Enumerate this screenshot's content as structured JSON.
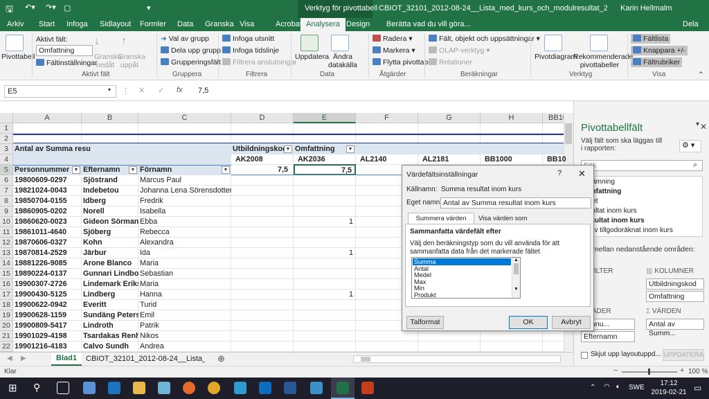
{
  "titlebar": {
    "context_group": "Verktyg för pivottabell",
    "doc_title": "CBIOT_32101_2012-08-24__Lista_med_kurs_och_modulresultat_2019-02-21.csv [Sk...",
    "user": "Karin Hellmalm",
    "share": "Dela"
  },
  "tabs": [
    "Arkiv",
    "Start",
    "Infoga",
    "Sidlayout",
    "Formler",
    "Data",
    "Granska",
    "Visa",
    "Acrobat",
    "Analysera",
    "Design"
  ],
  "tell_me": "Berätta vad du vill göra...",
  "ribbon": {
    "pivot_label": "Pivottabell",
    "active_field_label": "Aktivt fält:",
    "active_field_value": "Omfattning",
    "field_settings": "Fältinställningar",
    "drill_down": "Granska nedåt",
    "drill_up": "Granska uppåt",
    "group_active_field": "Aktivt fält",
    "group_selection": "Val av grupp",
    "ungroup": "Dela upp grupp",
    "group_field": "Grupperingsfält",
    "group_grouping": "Gruppera",
    "insert_slicer": "Infoga utsnitt",
    "insert_timeline": "Infoga tidslinje",
    "filter_connections": "Filtrera anslutningar",
    "group_filter": "Filtrera",
    "refresh": "Uppdatera",
    "change_source": "Ändra datakälla",
    "group_data": "Data",
    "clear": "Radera",
    "select": "Markera",
    "move_pivot": "Flytta pivottabell",
    "group_actions": "Åtgärder",
    "fields_items_sets": "Fält, objekt och uppsättningar",
    "olap_tools": "OLAP-verktyg",
    "relations": "Relationer",
    "group_calculations": "Beräkningar",
    "pivotchart": "Pivotdiagram",
    "recommended": "Rekommenderade pivottabeller",
    "group_tools": "Verktyg",
    "field_list": "Fältlista",
    "buttons": "Knappara +/-",
    "field_headers": "Fältrubriker",
    "group_show": "Visa"
  },
  "formula": {
    "namebox": "E5",
    "value": "7,5"
  },
  "columns": [
    "A",
    "B",
    "C",
    "D",
    "E",
    "F",
    "G",
    "H",
    "BB10"
  ],
  "pivot": {
    "title": "Antal av Summa resu",
    "col_field1": "Utbildningskod",
    "col_field2": "Omfattning",
    "col_codes": [
      "AK2008",
      "AK2036",
      "AL2140",
      "AL2181",
      "BB1000",
      "BB10"
    ],
    "row_headers": [
      "Personnummer",
      "Efternamn",
      "Förnamn"
    ],
    "row5_values": [
      "7,5",
      "7,5"
    ],
    "rows": [
      {
        "n": "6",
        "pnr": "19800609-0297",
        "last": "Sjöstrand",
        "first": "Marcus Paul",
        "e": ""
      },
      {
        "n": "7",
        "pnr": "19821024-0043",
        "last": "Indebetou",
        "first": "Johanna Lena Sörensdotter",
        "e": ""
      },
      {
        "n": "8",
        "pnr": "19850704-0155",
        "last": "Idberg",
        "first": "Fredrik",
        "e": ""
      },
      {
        "n": "9",
        "pnr": "19860905-0202",
        "last": "Norell",
        "first": "Isabella",
        "e": ""
      },
      {
        "n": "10",
        "pnr": "19860620-0023",
        "last": "Gideon Sörman",
        "first": "Ebba",
        "e": "1"
      },
      {
        "n": "11",
        "pnr": "19861011-4640",
        "last": "Sjöberg",
        "first": "Rebecca",
        "e": ""
      },
      {
        "n": "12",
        "pnr": "19870606-0327",
        "last": "Kohn",
        "first": "Alexandra",
        "e": ""
      },
      {
        "n": "13",
        "pnr": "19870814-2529",
        "last": "Järbur",
        "first": "Ida",
        "e": "1"
      },
      {
        "n": "14",
        "pnr": "19881226-9085",
        "last": "Arone Blanco",
        "first": "Maria",
        "e": ""
      },
      {
        "n": "15",
        "pnr": "19890224-0137",
        "last": "Gunnari Lindbom",
        "first": "Sebastian",
        "e": ""
      },
      {
        "n": "16",
        "pnr": "19900307-2726",
        "last": "Lindemark Eriks",
        "first": "Maria",
        "e": ""
      },
      {
        "n": "17",
        "pnr": "19900430-5125",
        "last": "Lindberg",
        "first": "Hanna",
        "e": "1"
      },
      {
        "n": "18",
        "pnr": "19900622-0942",
        "last": "Everitt",
        "first": "Turid",
        "e": ""
      },
      {
        "n": "19",
        "pnr": "19900628-1159",
        "last": "Sundäng Peters",
        "first": "Emil",
        "e": ""
      },
      {
        "n": "20",
        "pnr": "19900809-5417",
        "last": "Lindroth",
        "first": "Patrik",
        "e": ""
      },
      {
        "n": "21",
        "pnr": "19901029-4198",
        "last": "Tsardakas Renh",
        "first": "Nikos",
        "e": ""
      },
      {
        "n": "22",
        "pnr": "19901216-4183",
        "last": "Calvo Sundh",
        "first": "Andrea",
        "e": ""
      }
    ]
  },
  "sheets": {
    "active": "Blad1",
    "other": "CBIOT_32101_2012-08-24__Lista_m"
  },
  "status": {
    "ready": "Klar",
    "zoom": "100 %"
  },
  "pane": {
    "title": "Pivottabellfält",
    "subtitle": "Välj fält som ska läggas till i rapporten:",
    "search": "Sök",
    "fields": [
      "enämning",
      "Omfattning",
      "nhet",
      "esultat inom kurs",
      "resultat inom kurs",
      "arav tillgodoräknat inom kurs"
    ],
    "drag_label": "fält mellan nedanstående områden:",
    "filter": "FILTER",
    "columns": "KOLUMNER",
    "col_items": [
      "Utbildningskod",
      "Omfattning"
    ],
    "rows": "RADER",
    "values": "VÄRDEN",
    "row_items": [
      "sonnu...",
      "Efternamn"
    ],
    "value_items": [
      "Antal av Summ..."
    ],
    "defer": "Skjut upp layoutuppd...",
    "update": "UPPDATERA"
  },
  "dialog": {
    "title": "Värdefältsinställningar",
    "source_label": "Källnamn:",
    "source_value": "Summa resultat inom kurs",
    "custom_label": "Eget namn:",
    "custom_value": "Antal av Summa resultat inom kurs",
    "tab1": "Summera värden efter",
    "tab2": "Visa värden som",
    "section": "Sammanfatta värdefält efter",
    "desc": "Välj den beräkningstyp som du vill använda för att sammanfatta data från det markerade fältet",
    "options": [
      "Summa",
      "Antal",
      "Medel",
      "Max",
      "Min",
      "Produkt"
    ],
    "number_format": "Talformat",
    "ok": "OK",
    "cancel": "Avbryt"
  },
  "taskbar": {
    "lang": "SWE",
    "time": "17:12",
    "date": "2019-02-21"
  }
}
